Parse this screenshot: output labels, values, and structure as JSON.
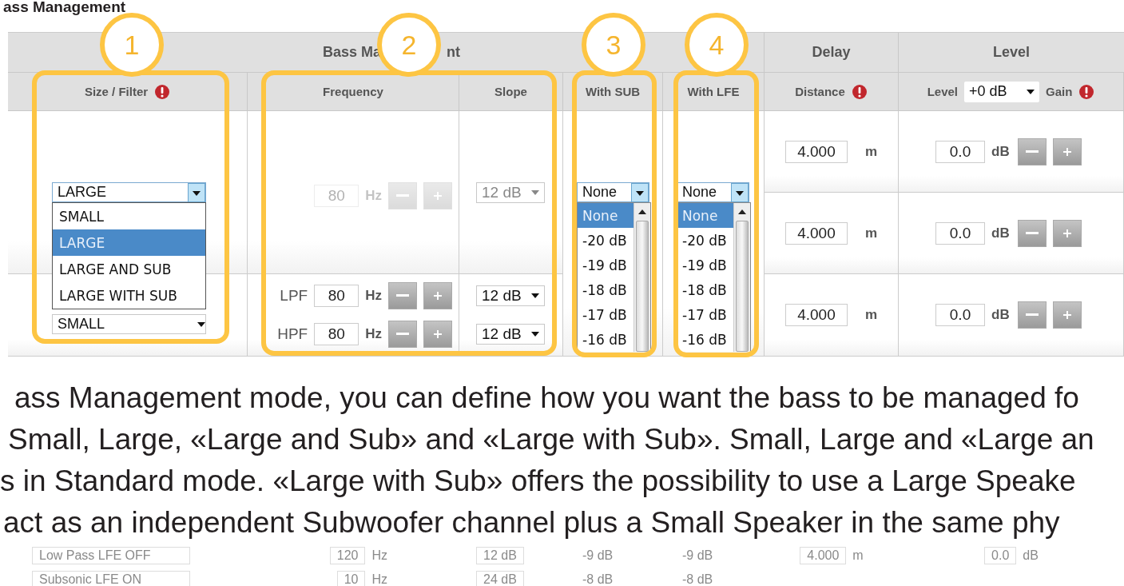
{
  "title": "ass Management",
  "table": {
    "group_header": {
      "bass_left": "Bass Ma",
      "bass_right": "nt",
      "delay": "Delay",
      "level": "Level"
    },
    "columns": {
      "size_filter": "Size / Filter",
      "frequency": "Frequency",
      "slope": "Slope",
      "with_sub": "With SUB",
      "with_lfe": "With LFE",
      "distance": "Distance",
      "level_label": "Level",
      "level_select": "+0 dB",
      "gain": "Gain"
    },
    "size_filter": {
      "value": "LARGE",
      "expanded": true,
      "options": [
        {
          "label": "SMALL",
          "selected": false
        },
        {
          "label": "LARGE",
          "selected": true
        },
        {
          "label": "LARGE AND SUB",
          "selected": false
        },
        {
          "label": "LARGE WITH SUB",
          "selected": false
        }
      ]
    },
    "size_filter_2": {
      "value": "SMALL"
    },
    "filters": [
      {
        "value": "80",
        "unit": "Hz",
        "slope": "12 dB",
        "disabled": true
      },
      {
        "label": "LPF",
        "value": "80",
        "unit": "Hz",
        "slope": "12 dB",
        "disabled": false
      },
      {
        "label": "HPF",
        "value": "80",
        "unit": "Hz",
        "slope": "12 dB",
        "disabled": false
      }
    ],
    "with_sub": {
      "value": "None",
      "expanded": true,
      "options": [
        {
          "label": "None",
          "selected": true
        },
        {
          "label": "-20 dB",
          "selected": false
        },
        {
          "label": "-19 dB",
          "selected": false
        },
        {
          "label": "-18 dB",
          "selected": false
        },
        {
          "label": "-17 dB",
          "selected": false
        },
        {
          "label": "-16 dB",
          "selected": false
        }
      ]
    },
    "with_lfe": {
      "value": "None",
      "expanded": true,
      "options": [
        {
          "label": "None",
          "selected": true
        },
        {
          "label": "-20 dB",
          "selected": false
        },
        {
          "label": "-19 dB",
          "selected": false
        },
        {
          "label": "-18 dB",
          "selected": false
        },
        {
          "label": "-17 dB",
          "selected": false
        },
        {
          "label": "-16 dB",
          "selected": false
        }
      ]
    },
    "rows": [
      {
        "distance": "4.000",
        "distance_unit": "m",
        "level": "0.0",
        "level_unit": "dB"
      },
      {
        "distance": "4.000",
        "distance_unit": "m",
        "level": "0.0",
        "level_unit": "dB"
      },
      {
        "distance": "4.000",
        "distance_unit": "m",
        "level": "0.0",
        "level_unit": "dB"
      }
    ]
  },
  "annotations": [
    {
      "number": "1"
    },
    {
      "number": "2"
    },
    {
      "number": "3"
    },
    {
      "number": "4"
    }
  ],
  "paragraph_lines": [
    "ass Management mode, you can define how you want the bass to be managed fo",
    "Small, Large, «Large and Sub» and «Large with Sub». Small, Large and «Large an",
    "s in Standard mode. «Large with Sub» offers the possibility to use a Large Speake",
    "act as an independent Subwoofer channel plus a Small Speaker in the same phy"
  ],
  "faded_rows": [
    {
      "filter": "Low Pass LFE OFF",
      "freq": "120",
      "unit": "Hz",
      "slope": "12 dB",
      "sub": "-9 dB",
      "lfe": "-9 dB",
      "distance": "4.000",
      "distance_unit": "m",
      "level": "0.0",
      "level_unit": "dB"
    },
    {
      "filter": "Subsonic LFE ON",
      "freq": "10",
      "unit": "Hz",
      "slope": "24 dB",
      "sub": "-8 dB",
      "lfe": "-8 dB"
    }
  ]
}
